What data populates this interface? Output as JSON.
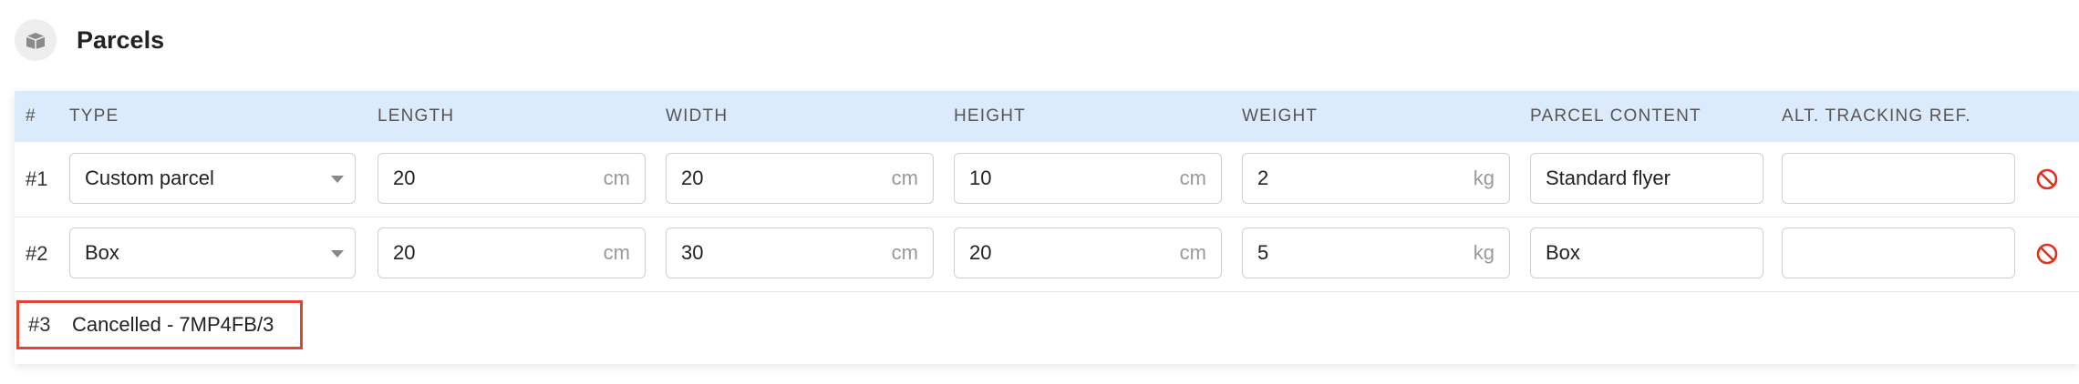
{
  "section": {
    "title": "Parcels",
    "icon": "box-icon"
  },
  "table": {
    "columns": [
      "#",
      "TYPE",
      "LENGTH",
      "WIDTH",
      "HEIGHT",
      "WEIGHT",
      "PARCEL CONTENT",
      "ALT. TRACKING REF."
    ],
    "rows": [
      {
        "num": "#1",
        "type": "Custom parcel",
        "length": "20",
        "length_unit": "cm",
        "width": "20",
        "width_unit": "cm",
        "height": "10",
        "height_unit": "cm",
        "weight": "2",
        "weight_unit": "kg",
        "content": "Standard flyer",
        "alt_ref": ""
      },
      {
        "num": "#2",
        "type": "Box",
        "length": "20",
        "length_unit": "cm",
        "width": "30",
        "width_unit": "cm",
        "height": "20",
        "height_unit": "cm",
        "weight": "5",
        "weight_unit": "kg",
        "content": "Box",
        "alt_ref": ""
      }
    ],
    "cancelled": {
      "num": "#3",
      "text": "Cancelled - 7MP4FB/3"
    }
  },
  "colors": {
    "header_bg": "#dcebfb",
    "remove_icon": "#e0301e",
    "highlight_border": "#e2452f"
  }
}
